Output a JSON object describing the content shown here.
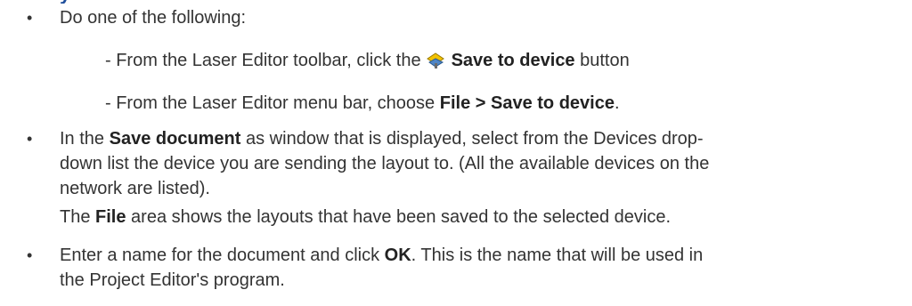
{
  "header_fragment": "y",
  "intro": "Do one of the following:",
  "options": {
    "toolbar": {
      "prefix": "- From the Laser Editor toolbar, click the",
      "button": "Save to device",
      "suffix": "button"
    },
    "menu": {
      "prefix": "- From the Laser Editor menu bar, choose",
      "path": "File > Save to device",
      "suffix": "."
    }
  },
  "step_save_document": {
    "part1": "In the",
    "window_name": "Save document",
    "part2": "as window that is displayed, select from the Devices drop-",
    "line2": "down list the device you are sending the layout to. (All the available devices on the",
    "line3": "network are listed).",
    "note_part1": "The",
    "note_area": "File",
    "note_part2": "area shows the layouts that have been saved to the selected device."
  },
  "step_enter_name": {
    "part1": "Enter a name for the document and click",
    "ok": "OK",
    "part2": ". This is the name that will be used in",
    "line2": "the Project Editor's program."
  },
  "colors": {
    "text": "#333333",
    "heading": "#1f4e9c"
  }
}
